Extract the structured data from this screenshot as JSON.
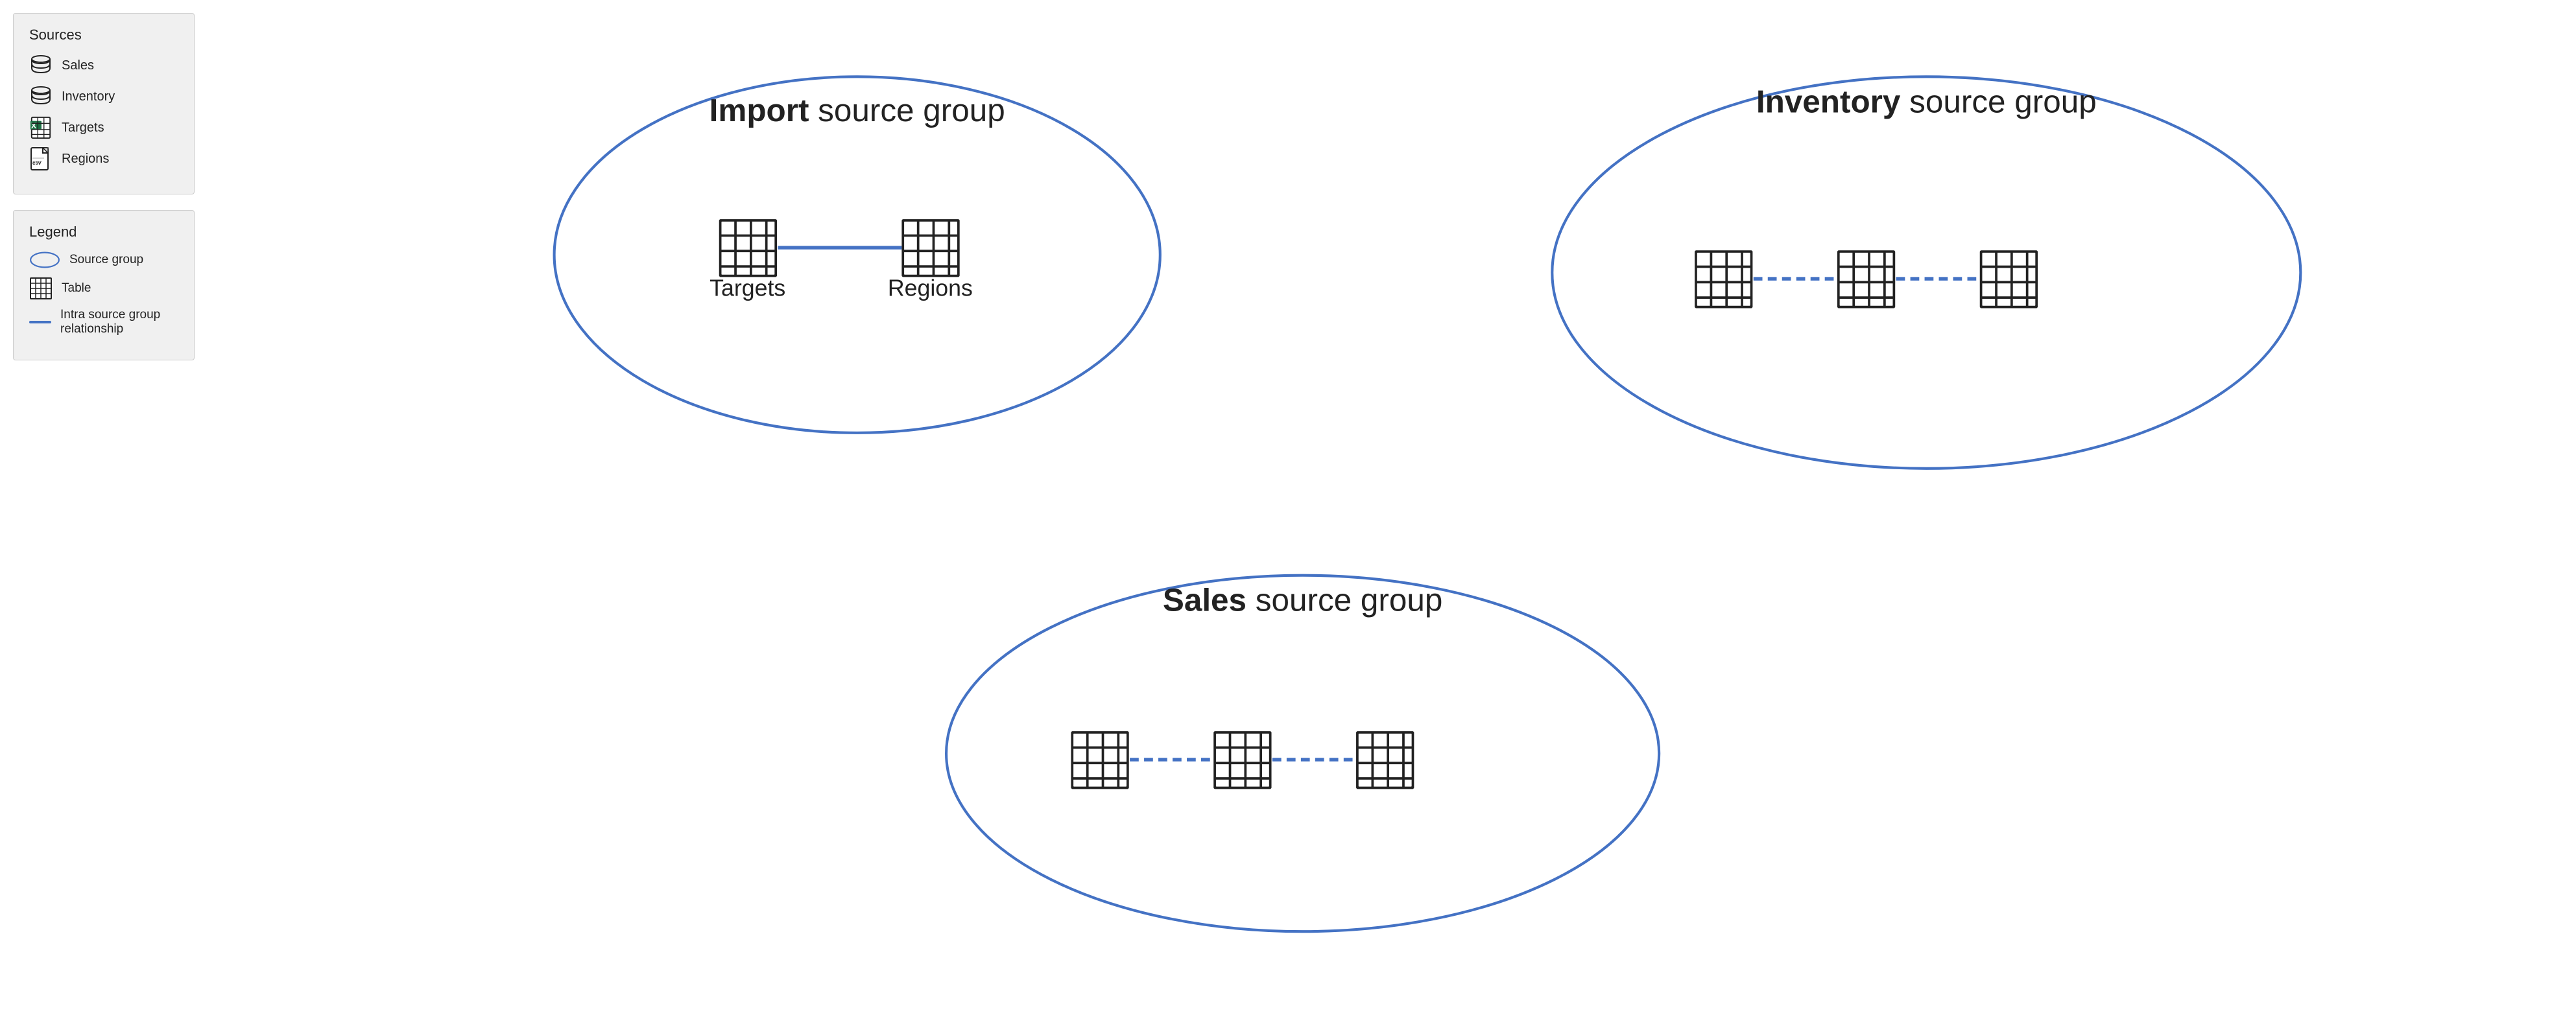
{
  "left": {
    "sources": {
      "title": "Sources",
      "items": [
        {
          "id": "sales",
          "label": "Sales",
          "icon": "database"
        },
        {
          "id": "inventory",
          "label": "Inventory",
          "icon": "database"
        },
        {
          "id": "targets",
          "label": "Targets",
          "icon": "excel"
        },
        {
          "id": "regions",
          "label": "Regions",
          "icon": "csv"
        }
      ]
    },
    "legend": {
      "title": "Legend",
      "items": [
        {
          "id": "source-group",
          "label": "Source group",
          "icon": "ellipse"
        },
        {
          "id": "table",
          "label": "Table",
          "icon": "table"
        },
        {
          "id": "relationship",
          "label": "Intra source group relationship",
          "icon": "line"
        }
      ]
    }
  },
  "diagram": {
    "groups": [
      {
        "id": "import-group",
        "title_bold": "Import",
        "title_rest": " source group",
        "tables": [
          {
            "id": "t1",
            "label": "Targets"
          },
          {
            "id": "t2",
            "label": "Regions"
          }
        ],
        "connectors": 1
      },
      {
        "id": "inventory-group",
        "title_bold": "Inventory",
        "title_rest": " source group",
        "tables": [
          {
            "id": "t1",
            "label": ""
          },
          {
            "id": "t2",
            "label": ""
          },
          {
            "id": "t3",
            "label": ""
          }
        ],
        "connectors": 2
      },
      {
        "id": "sales-group",
        "title_bold": "Sales",
        "title_rest": " source group",
        "tables": [
          {
            "id": "t1",
            "label": ""
          },
          {
            "id": "t2",
            "label": ""
          },
          {
            "id": "t3",
            "label": ""
          }
        ],
        "connectors": 2
      }
    ]
  },
  "colors": {
    "ellipse_stroke": "#4472c4",
    "connector": "#4472c4",
    "panel_bg": "#f0f0f0"
  }
}
